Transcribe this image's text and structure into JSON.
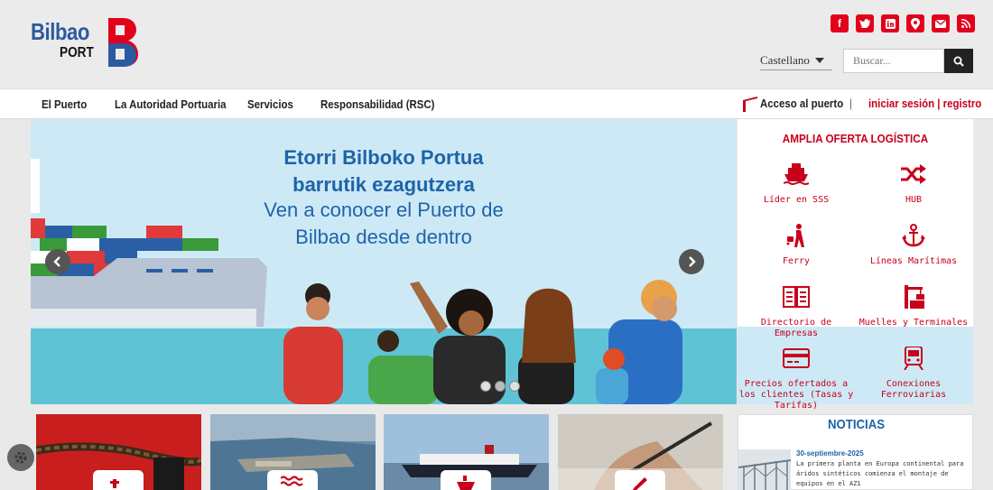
{
  "brand": {
    "name": "Bilbao",
    "sub": "PORT",
    "mark": "B"
  },
  "colors": {
    "accent": "#c8001b",
    "brand_blue": "#2c5aa0",
    "sky": "#cde9f6"
  },
  "social": [
    {
      "icon": "facebook-icon",
      "glyph": "f"
    },
    {
      "icon": "twitter-icon",
      "glyph": "t"
    },
    {
      "icon": "linkedin-icon",
      "glyph": "in"
    },
    {
      "icon": "map-marker-icon",
      "glyph": "⚲"
    },
    {
      "icon": "mail-icon",
      "glyph": "✉"
    },
    {
      "icon": "rss-icon",
      "glyph": "≋"
    }
  ],
  "language": {
    "selected": "Castellano"
  },
  "search": {
    "placeholder": "Buscar..."
  },
  "nav": {
    "items": [
      "El Puerto",
      "La Autoridad Portuaria",
      "Servicios",
      "Responsabilidad (RSC)"
    ],
    "access": "Acceso al puerto",
    "separator": "|",
    "login": "iniciar sesión | registro"
  },
  "hero": {
    "line1": "Etorri Bilboko Portua",
    "line2": "barrutik ezagutzera",
    "line3": "Ven a conocer el Puerto de",
    "line4": "Bilbao desde dentro",
    "slides": 3,
    "active_slide": 2
  },
  "logistics": {
    "title": "AMPLIA OFERTA LOGÍSTICA",
    "items": [
      {
        "label": "Líder en SSS",
        "icon": "ship-icon"
      },
      {
        "label": "HUB",
        "icon": "shuffle-icon"
      },
      {
        "label": "Ferry",
        "icon": "traveler-icon"
      },
      {
        "label": "Líneas Marítimas",
        "icon": "anchor-icon"
      },
      {
        "label": "Directorio de Empresas",
        "icon": "book-icon"
      },
      {
        "label": "Muelles y Terminales",
        "icon": "crane-icon"
      },
      {
        "label": "Precios ofertados a los clientes (Tasas y Tarifas)",
        "icon": "credit-card-icon"
      },
      {
        "label": "Conexiones Ferroviarias",
        "icon": "train-icon"
      }
    ]
  },
  "news": {
    "title": "NOTICIAS",
    "date": "30-septiembre-2025",
    "text": "La primera planta en Europa continental para áridos sintéticos comienza el montaje de equipos en el AZ1"
  }
}
